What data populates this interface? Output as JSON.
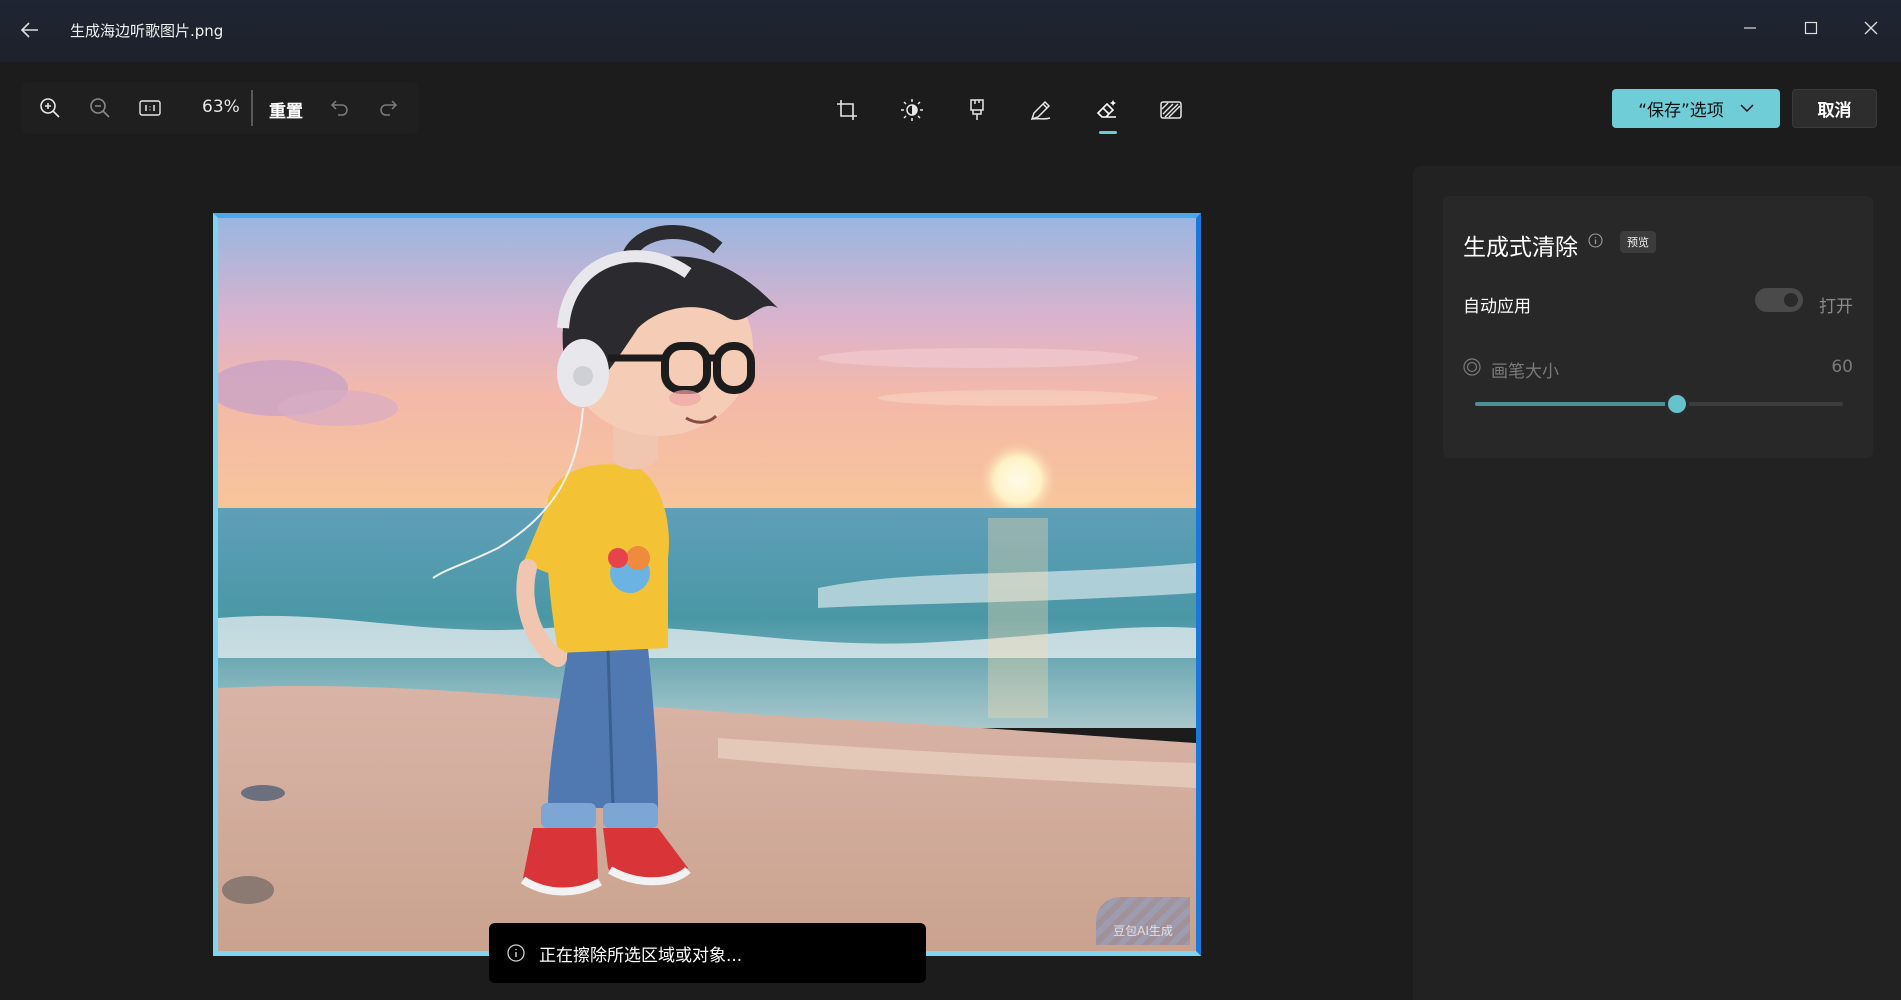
{
  "window": {
    "title": "生成海边听歌图片.png",
    "back_icon": "arrow-left-icon",
    "controls": [
      "minimize-icon",
      "maximize-icon",
      "close-icon"
    ]
  },
  "toolbar": {
    "zoom_in_icon": "zoom-in-icon",
    "zoom_out_icon": "zoom-out-icon",
    "actual_size_icon": "actual-size-icon",
    "zoom_level": "63%",
    "reset_label": "重置",
    "undo_icon": "undo-icon",
    "redo_icon": "redo-icon"
  },
  "tools": [
    {
      "name": "crop",
      "icon": "crop-icon"
    },
    {
      "name": "adjust",
      "icon": "brightness-icon"
    },
    {
      "name": "filter",
      "icon": "filter-brush-icon"
    },
    {
      "name": "markup",
      "icon": "pen-icon"
    },
    {
      "name": "erase",
      "icon": "eraser-icon",
      "active": true
    },
    {
      "name": "background",
      "icon": "background-blur-icon"
    }
  ],
  "actions": {
    "save_label": "“保存”选项",
    "cancel_label": "取消"
  },
  "canvas": {
    "watermark_text": "豆包AI生成"
  },
  "toast": {
    "text": "正在擦除所选区域或对象..."
  },
  "panel": {
    "title": "生成式清除",
    "badge": "预览",
    "auto_apply_label": "自动应用",
    "auto_apply_state": "打开",
    "brush_size_label": "画笔大小",
    "brush_size_value": "60",
    "brush_size_fraction": 0.55
  },
  "colors": {
    "accent": "#6ecdd7",
    "background": "#1c1c1c",
    "panel": "#282828"
  }
}
